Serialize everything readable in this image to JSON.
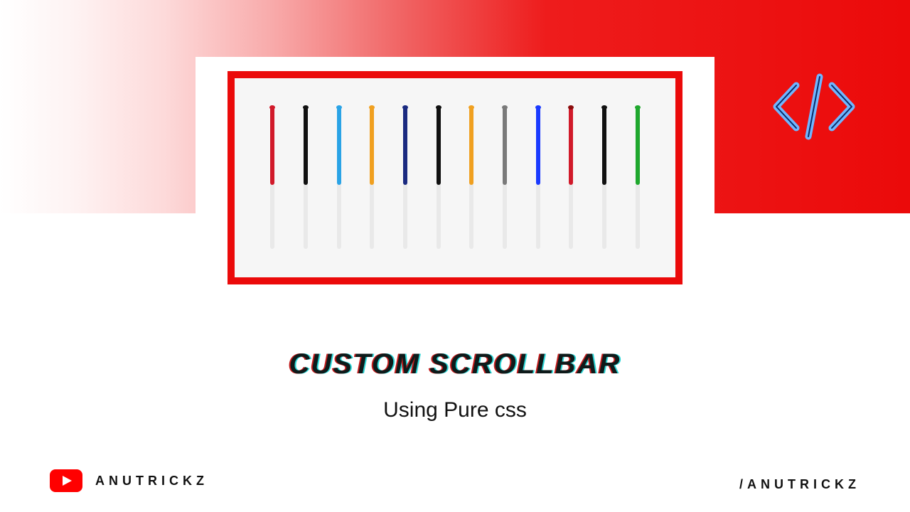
{
  "title": "CUSTOM SCROLLBAR",
  "subtitle": "Using Pure css",
  "footer": {
    "left_label": "ANUTRICKZ",
    "right_label": "/ANUTRICKZ"
  },
  "icons": {
    "code": "code-icon",
    "youtube": "youtube-icon"
  },
  "colors": {
    "red": "#eb0a0a",
    "youtube_red": "#ff0000"
  },
  "scrollbars": [
    {
      "color": "#d11a2a",
      "cap": "#d11a2a"
    },
    {
      "color": "#111111",
      "cap": "#111111"
    },
    {
      "color": "#2aa3e6",
      "cap": "#2aa3e6"
    },
    {
      "color": "#f0a020",
      "cap": "#f0a020"
    },
    {
      "color": "#1a2a80",
      "cap": "#1a2a80"
    },
    {
      "color": "#111111",
      "cap": "#111111"
    },
    {
      "color": "#f0a020",
      "cap": "#f0a020"
    },
    {
      "color": "#7a7a7a",
      "cap": "#7a7a7a"
    },
    {
      "color": "#1a3aff",
      "cap": "#1a3aff"
    },
    {
      "color": "#d11a2a",
      "cap": "#8a0d0d"
    },
    {
      "color": "#111111",
      "cap": "#111111"
    },
    {
      "color": "#1fa82e",
      "cap": "#1fa82e"
    }
  ]
}
